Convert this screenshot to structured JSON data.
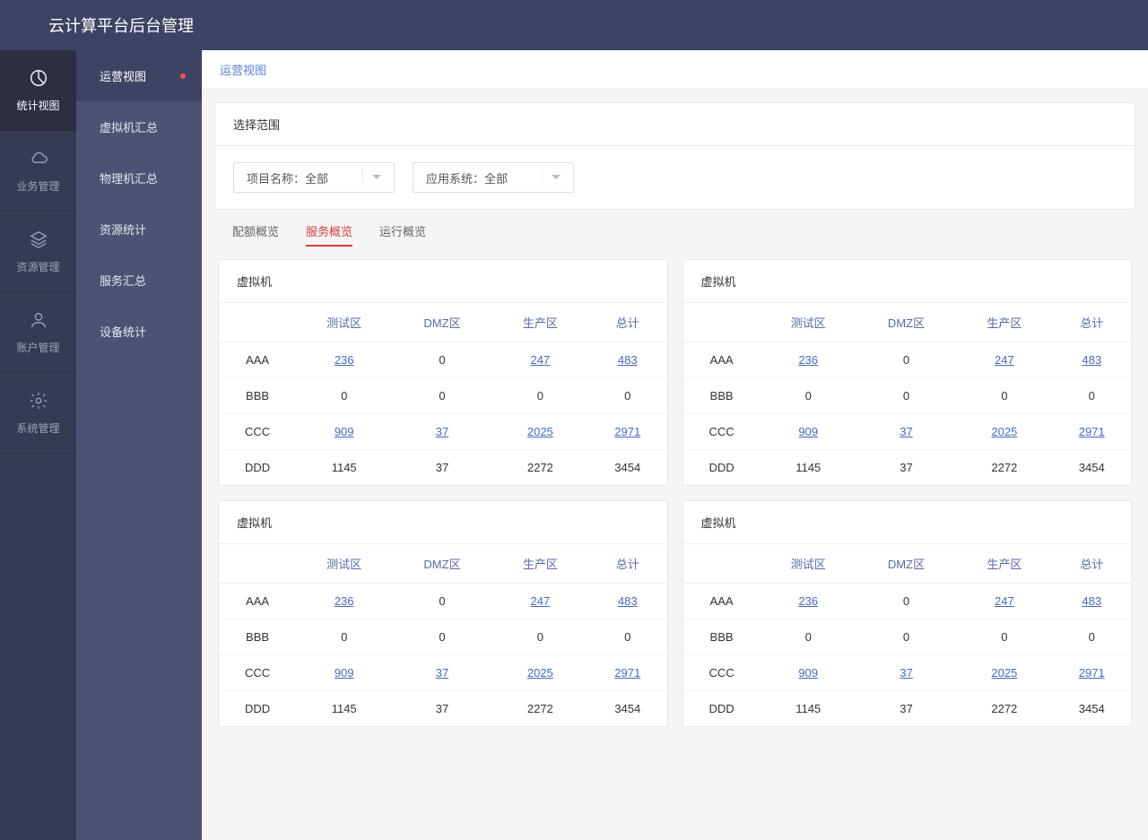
{
  "header": {
    "title": "云计算平台后台管理"
  },
  "sidebar_primary": [
    {
      "label": "统计视图",
      "icon": "pie",
      "active": true
    },
    {
      "label": "业务管理",
      "icon": "cloud",
      "active": false
    },
    {
      "label": "资源管理",
      "icon": "layers",
      "active": false
    },
    {
      "label": "账户管理",
      "icon": "user",
      "active": false
    },
    {
      "label": "系统管理",
      "icon": "gear",
      "active": false
    }
  ],
  "sidebar_secondary": [
    {
      "label": "运营视图",
      "active": true,
      "dot": true
    },
    {
      "label": "虚拟机汇总",
      "active": false,
      "dot": false
    },
    {
      "label": "物理机汇总",
      "active": false,
      "dot": false
    },
    {
      "label": "资源统计",
      "active": false,
      "dot": false
    },
    {
      "label": "服务汇总",
      "active": false,
      "dot": false
    },
    {
      "label": "设备统计",
      "active": false,
      "dot": false
    }
  ],
  "breadcrumb": {
    "current": "运营视图"
  },
  "filter": {
    "title": "选择范围",
    "selects": [
      {
        "label": "项目名称：全部"
      },
      {
        "label": "应用系统：全部"
      }
    ]
  },
  "tabs": [
    {
      "label": "配额概览",
      "active": false
    },
    {
      "label": "服务概览",
      "active": true
    },
    {
      "label": "运行概览",
      "active": false
    }
  ],
  "table_panel": {
    "title": "虚拟机",
    "columns": [
      "测试区",
      "DMZ区",
      "生产区",
      "总计"
    ],
    "rows": [
      {
        "name": "AAA",
        "cells": [
          {
            "v": "236",
            "link": true
          },
          {
            "v": "0",
            "link": false
          },
          {
            "v": "247",
            "link": true
          },
          {
            "v": "483",
            "link": true
          }
        ]
      },
      {
        "name": "BBB",
        "cells": [
          {
            "v": "0",
            "link": false
          },
          {
            "v": "0",
            "link": false
          },
          {
            "v": "0",
            "link": false
          },
          {
            "v": "0",
            "link": false
          }
        ]
      },
      {
        "name": "CCC",
        "cells": [
          {
            "v": "909",
            "link": true
          },
          {
            "v": "37",
            "link": true
          },
          {
            "v": "2025",
            "link": true
          },
          {
            "v": "2971",
            "link": true
          }
        ]
      },
      {
        "name": "DDD",
        "cells": [
          {
            "v": "1145",
            "link": false
          },
          {
            "v": "37",
            "link": false
          },
          {
            "v": "2272",
            "link": false
          },
          {
            "v": "3454",
            "link": false
          }
        ]
      }
    ]
  },
  "panel_count": 4
}
